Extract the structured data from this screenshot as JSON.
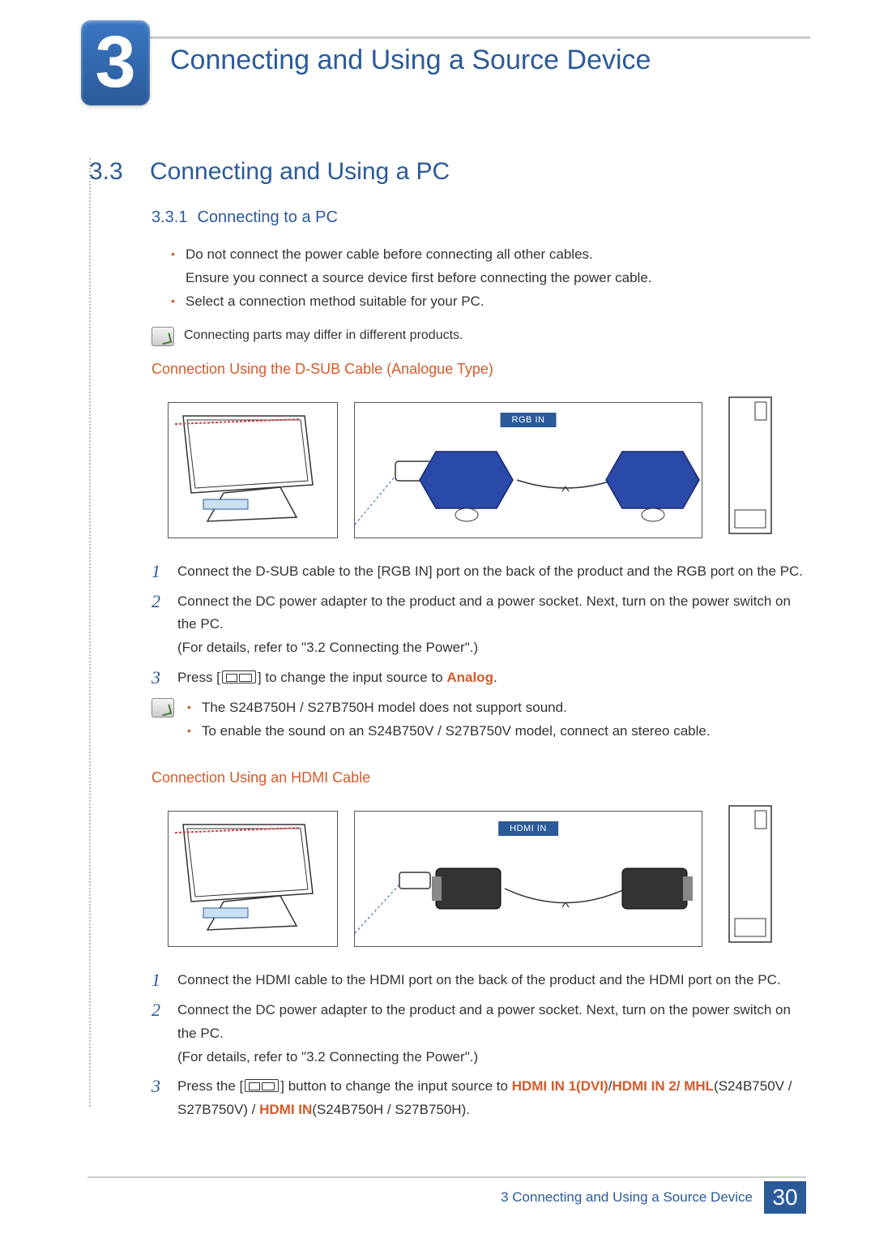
{
  "chapter": {
    "number": "3",
    "title": "Connecting and Using a Source Device"
  },
  "section": {
    "number": "3.3",
    "title": "Connecting and Using a PC"
  },
  "subsection": {
    "number": "3.3.1",
    "title": "Connecting to a PC"
  },
  "intro_bullets": [
    "Do not connect the power cable before connecting all other cables.\nEnsure you connect a source device first before connecting the power cable.",
    "Select a connection method suitable for your PC."
  ],
  "intro_note": "Connecting parts may differ in different products.",
  "dsub": {
    "heading": "Connection Using the D-SUB Cable (Analogue Type)",
    "port_label": "RGB IN",
    "steps": {
      "s1": "Connect the D-SUB cable to the [RGB IN] port on the back of the product and the RGB port on the PC.",
      "s2a": "Connect the DC power adapter to the product and a power socket. Next, turn on the power switch on the PC.",
      "s2b": "(For details, refer to \"3.2 Connecting the Power\".)",
      "s3_pre": "Press [",
      "s3_post": "] to change the input source to ",
      "s3_target": "Analog",
      "s3_end": "."
    },
    "note_bullets": [
      "The S24B750H / S27B750H model does not support sound.",
      "To enable the sound on an S24B750V / S27B750V model, connect an stereo cable."
    ]
  },
  "hdmi": {
    "heading": "Connection Using an HDMI Cable",
    "port_label": "HDMI IN",
    "steps": {
      "s1": "Connect the HDMI cable to the HDMI port on the back of the product and the HDMI port on the PC.",
      "s2a": "Connect the DC power adapter to the product and a power socket. Next, turn on the power switch on the PC.",
      "s2b": "(For details, refer to \"3.2 Connecting the Power\".)",
      "s3_pre": "Press the [",
      "s3_post": "] button to change the input source to ",
      "s3_t1": "HDMI IN 1(DVI)",
      "s3_sep1": "/",
      "s3_t2": "HDMI IN 2/ MHL",
      "s3_m1": "(S24B750V / S27B750V) / ",
      "s3_t3": "HDMI IN",
      "s3_m2": "(S24B750H / S27B750H)."
    }
  },
  "footer": {
    "text": "3 Connecting and Using a Source Device",
    "page": "30"
  }
}
